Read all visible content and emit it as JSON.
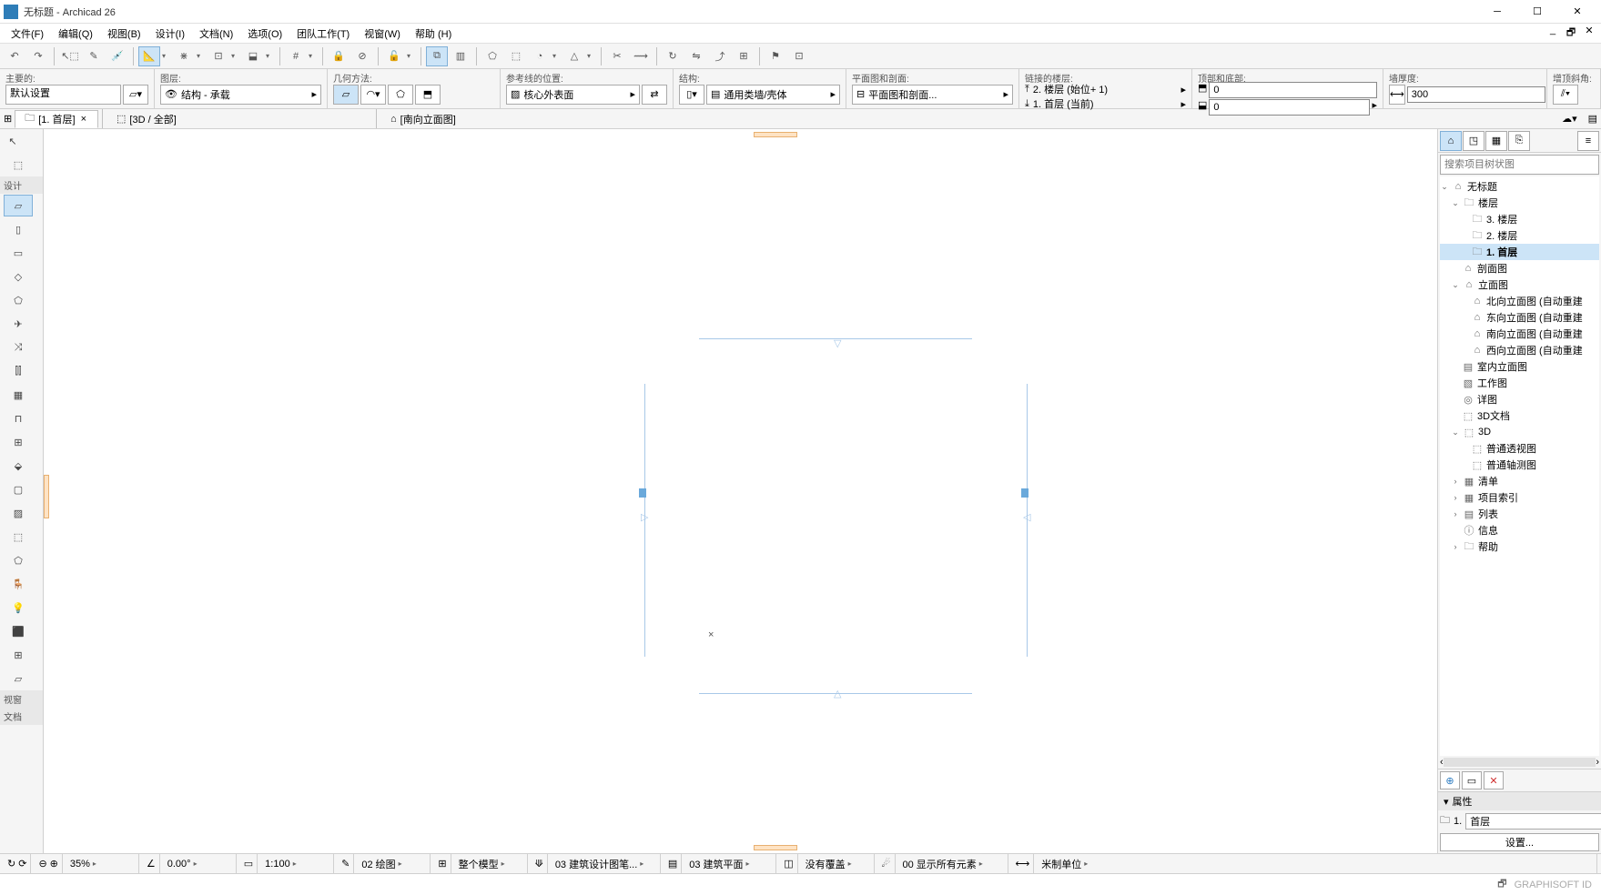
{
  "title": "无标题 - Archicad 26",
  "menu": [
    "文件(F)",
    "编辑(Q)",
    "视图(B)",
    "设计(I)",
    "文档(N)",
    "选项(O)",
    "团队工作(T)",
    "视窗(W)",
    "帮助 (H)"
  ],
  "infobar": {
    "main_label": "主要的:",
    "default_settings": "默认设置",
    "layer_label": "图层:",
    "layer_value": "结构 - 承载",
    "geom_label": "几何方法:",
    "refline_label": "参考线的位置:",
    "refline_value": "核心外表面",
    "struct_label": "结构:",
    "struct_value": "通用类墙/壳体",
    "floorplan_label": "平面图和剖面:",
    "floorplan_value": "平面图和剖面...",
    "linked_label": "链接的楼层:",
    "linked_top": "2. 楼层 (始位+ 1)",
    "linked_bot": "1. 首层 (当前)",
    "topbot_label": "顶部和底部:",
    "topbot_v1": "0",
    "topbot_v2": "0",
    "thick_label": "墙厚度:",
    "thick_value": "300",
    "slant_label": "增顶斜角:"
  },
  "tabs": {
    "t1": "[1. 首层]",
    "t2": "[3D / 全部]",
    "t3": "[南向立面图]"
  },
  "toolbox": {
    "g1": "设计",
    "g2": "视窗",
    "g3": "文档"
  },
  "navigator": {
    "search_ph": "搜索项目树状图",
    "root": "无标题",
    "floors": "楼层",
    "f3": "3. 楼层",
    "f2": "2. 楼层",
    "f1": "1. 首层",
    "section": "剖面图",
    "elev": "立面图",
    "e_n": "北向立面图 (自动重建",
    "e_e": "东向立面图 (自动重建",
    "e_s": "南向立面图 (自动重建",
    "e_w": "西向立面图 (自动重建",
    "intelev": "室内立面图",
    "worksheet": "工作图",
    "detail": "详图",
    "doc3d": "3D文档",
    "d3": "3D",
    "persp": "普通透视图",
    "axon": "普通轴测图",
    "sched": "清单",
    "index": "项目索引",
    "list": "列表",
    "info": "信息",
    "help": "帮助",
    "props_hdr": "属性",
    "props_id": "1.",
    "props_name": "首层",
    "settings": "设置..."
  },
  "status": {
    "zoom": "35%",
    "angle": "0.00°",
    "scale": "1:100",
    "penset": "02 绘图",
    "model": "整个模型",
    "reno": "03 建筑设计图笔...",
    "layer_combo": "03 建筑平面",
    "overlap": "没有覆盖",
    "show": "00 显示所有元素",
    "unit": "米制单位"
  },
  "branding": "GRAPHISOFT ID"
}
